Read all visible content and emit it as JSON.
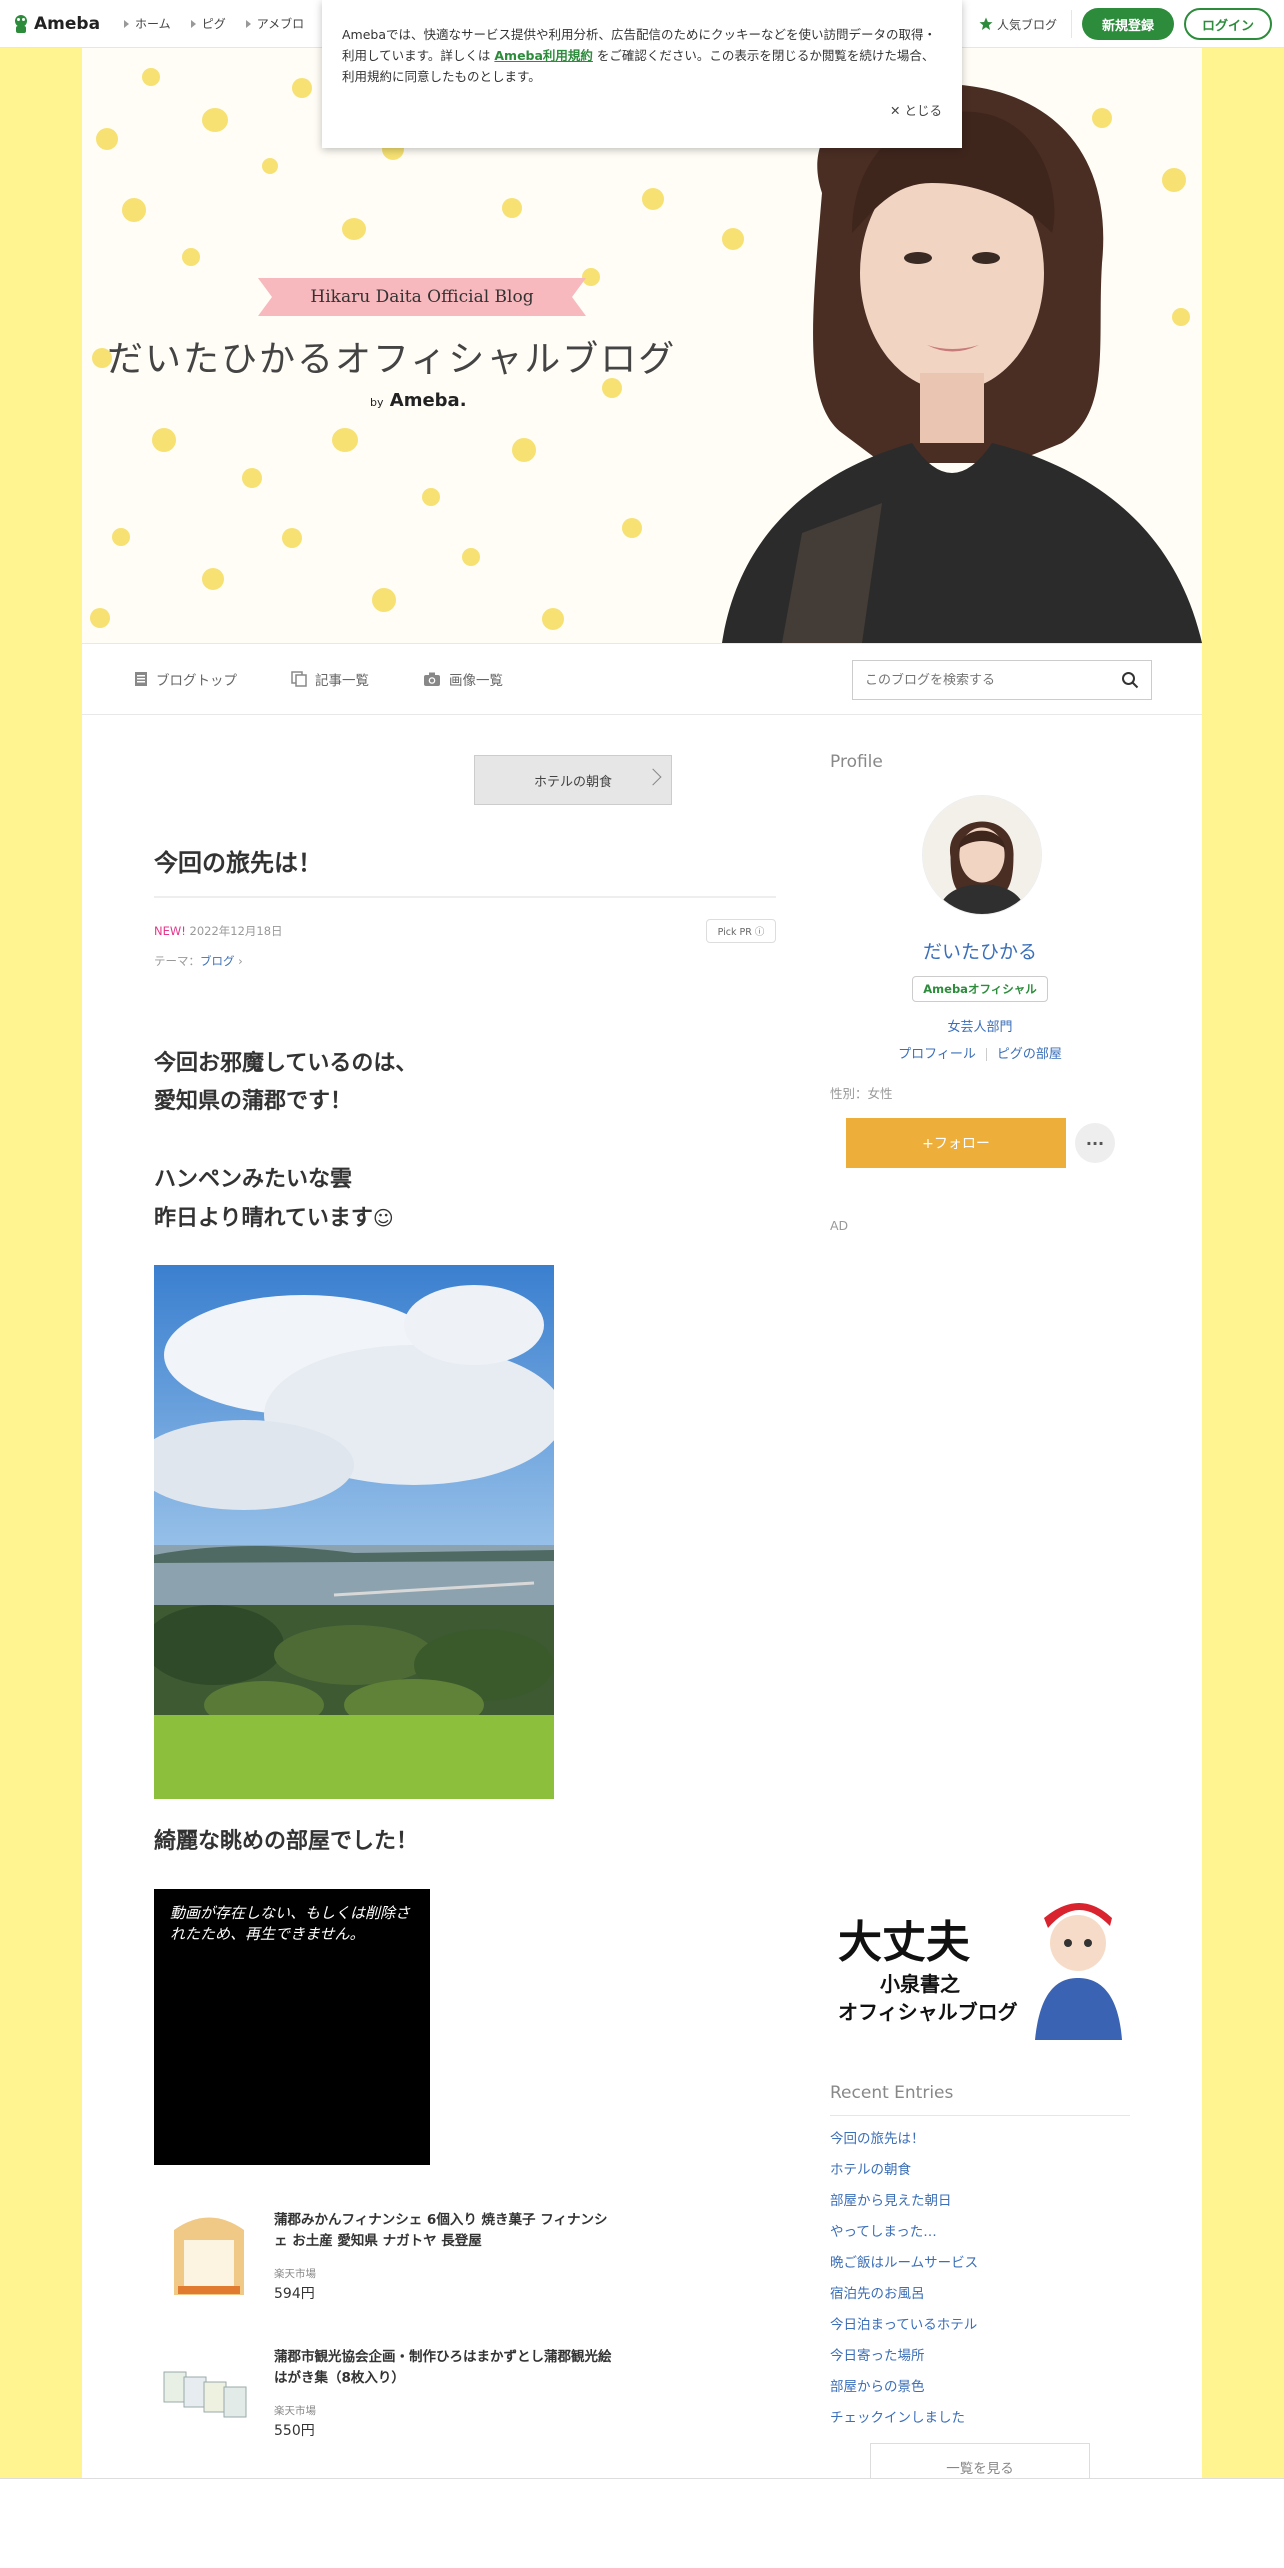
{
  "global_header": {
    "logo_text": "Ameba",
    "nav": [
      "ホーム",
      "ピグ",
      "アメブロ"
    ],
    "popular_label": "人気ブログ",
    "register_label": "新規登録",
    "login_label": "ログイン"
  },
  "cookie_notice": {
    "text_before": "Amebaでは、快適なサービス提供や利用分析、広告配信のためにクッキーなどを使い訪問データの取得・利用しています。詳しくは",
    "link_text": "Ameba利用規約",
    "text_after": "をご確認ください。この表示を閉じるか閲覧を続けた場合、利用規約に同意したものとします。",
    "close_label": "とじる"
  },
  "blog_header": {
    "ribbon_text": "Hikaru Daita Official Blog",
    "title": "だいたひかるオフィシャルブログ",
    "by_label": "by",
    "by_brand": "Ameba."
  },
  "blog_nav": {
    "items": [
      {
        "label": "ブログトップ",
        "icon": "document-icon"
      },
      {
        "label": "記事一覧",
        "icon": "copy-icon"
      },
      {
        "label": "画像一覧",
        "icon": "camera-icon"
      }
    ],
    "search_placeholder": "このブログを検索する"
  },
  "article": {
    "theme_button": "ホテルの朝食",
    "title": "今回の旅先は！",
    "new_badge": "NEW!",
    "date": "2022年12月18日",
    "pick_pr": "Pick PR ⓘ",
    "theme_prefix": "テーマ：",
    "theme": "ブログ",
    "para1_line1": "今回お邪魔しているのは、",
    "para1_line2": "愛知県の蒲郡です！",
    "para2_line1": "ハンペンみたいな雲",
    "para2_line2": "昨日より晴れています",
    "para3": "綺麗な眺めの部屋でした！",
    "video_message": "動画が存在しない、もしくは削除されたため、再生できません。",
    "products": [
      {
        "name": "蒲郡みかんフィナンシェ 6個入り 焼き菓子 フィナンシェ お土産 愛知県 ナガトヤ 長登屋",
        "shop": "楽天市場",
        "price": "594円"
      },
      {
        "name": "蒲郡市観光協会企画・制作ひろはまかずとし蒲郡観光絵はがき集（8枚入り）",
        "shop": "楽天市場",
        "price": "550円"
      }
    ]
  },
  "sidebar": {
    "profile_heading": "Profile",
    "name": "だいたひかる",
    "official_badge": "Amebaオフィシャル",
    "category": "女芸人部門",
    "links": [
      "プロフィール",
      "ピグの部屋"
    ],
    "gender": "性別：女性",
    "follow_label": "+フォロー",
    "more_label": "···",
    "ad_label": "AD",
    "ad_banner_text1": "大丈夫",
    "ad_banner_text2": "小泉書之",
    "ad_banner_text3": "オフィシャルブログ",
    "recent_heading": "Recent Entries",
    "recent_entries": [
      "今回の旅先は！",
      "ホテルの朝食",
      "部屋から見えた朝日",
      "やってしまった…",
      "晩ご飯はルームサービス",
      "宿泊先のお風呂",
      "今日泊まっているホテル",
      "今日寄った場所",
      "部屋からの景色",
      "チェックインしました"
    ],
    "see_all_label": "一覧を見る"
  },
  "colors": {
    "background": "#fff48f",
    "accent_green": "#2d8c3c",
    "link_blue": "#3b6fb8",
    "follow_orange": "#eeaf3a",
    "new_pink": "#e5358c"
  }
}
